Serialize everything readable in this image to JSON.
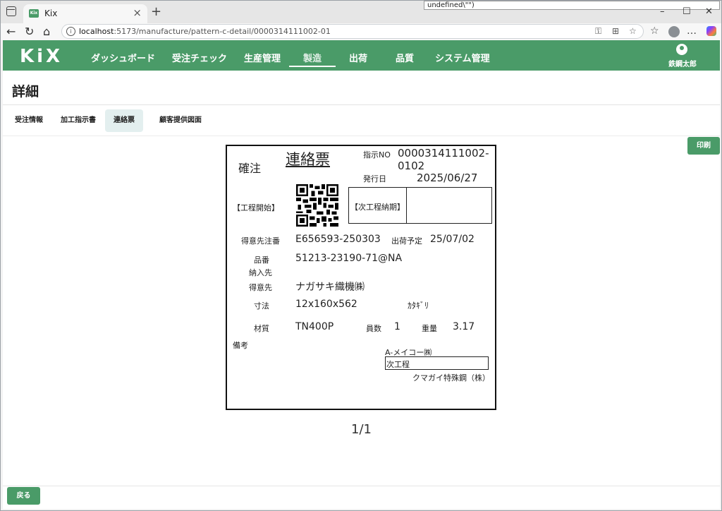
{
  "browser": {
    "tab_title": "Kix",
    "favicon_text": "Kix",
    "tooltip": "undefined\\\"\")",
    "url_host": "localhost",
    "url_rest": ":5173/manufacture/pattern-c-detail/0000314111002-01"
  },
  "app": {
    "logo": "KiX",
    "menu": [
      {
        "label": "ダッシュボード"
      },
      {
        "label": "受注チェック"
      },
      {
        "label": "生産管理"
      },
      {
        "label": "製造"
      },
      {
        "label": "出荷"
      },
      {
        "label": "品質"
      },
      {
        "label": "システム管理"
      }
    ],
    "active_menu": "製造",
    "user_name": "鉄鋼太郎"
  },
  "page": {
    "title": "詳細",
    "tabs": [
      {
        "label": "受注情報"
      },
      {
        "label": "加工指示書"
      },
      {
        "label": "連絡票"
      },
      {
        "label": "顧客提供図面"
      }
    ],
    "active_tab": "連絡票",
    "print_label": "印刷",
    "back_label": "戻る",
    "page_indicator": "1/1"
  },
  "sheet": {
    "status": "確注",
    "title": "連絡票",
    "instruction_no_label": "指示NO",
    "instruction_no_line1": "0000314111002-",
    "instruction_no_line2": "0102",
    "issue_date_label": "発行日",
    "issue_date": "2025/06/27",
    "process_start_label": "【工程開始】",
    "next_process_due_label": "【次工程納期】",
    "customer_order_label": "得意先注番",
    "customer_order": "E656593-250303",
    "ship_plan_label": "出荷予定",
    "ship_plan": "25/07/02",
    "part_no_label": "品番",
    "part_no": "51213-23190-71@NA",
    "delivery_label": "納入先",
    "customer_label": "得意先",
    "customer": "ナガサキ織機㈱",
    "dimension_label": "寸法",
    "dimension": "12x160x562",
    "shape": "ｶﾀｷﾞﾘ",
    "material_label": "材質",
    "material": "TN400P",
    "count_label": "員数",
    "count": "1",
    "weight_label": "重量",
    "weight": "3.17",
    "remarks_label": "備考",
    "maker": "A-メイコー㈱",
    "next_process_label": "次工程",
    "next_process_company": "クマガイ特殊鋼（株）"
  }
}
